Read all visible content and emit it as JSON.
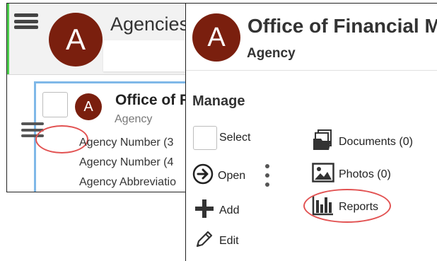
{
  "left_panel": {
    "app_title": "Agencies",
    "avatar_letter": "A",
    "card": {
      "avatar_letter": "A",
      "name": "Office of F",
      "type": "Agency",
      "lines": [
        "Agency Number (3",
        "Agency Number (4",
        "Agency Abbreviatio"
      ]
    }
  },
  "menu": {
    "avatar_letter": "A",
    "title": "Office of Financial M",
    "subtitle": "Agency",
    "section_label": "Manage",
    "items": {
      "select": "Select",
      "open": "Open",
      "add": "Add",
      "edit": "Edit",
      "documents": "Documents (0)",
      "photos": "Photos (0)",
      "reports": "Reports"
    }
  },
  "icons": {
    "hamburger": "hamburger-icon",
    "open": "arrow-circle-right-icon",
    "add": "plus-icon",
    "edit": "pencil-icon",
    "documents": "documents-icon",
    "photos": "photo-icon",
    "reports": "bar-chart-icon",
    "kebab": "kebab-menu-icon"
  },
  "colors": {
    "avatar": "#7a1f0e",
    "card_border": "#7fb8e8",
    "highlight_oval": "#e25252",
    "accent_bar": "#4ccf4c"
  }
}
